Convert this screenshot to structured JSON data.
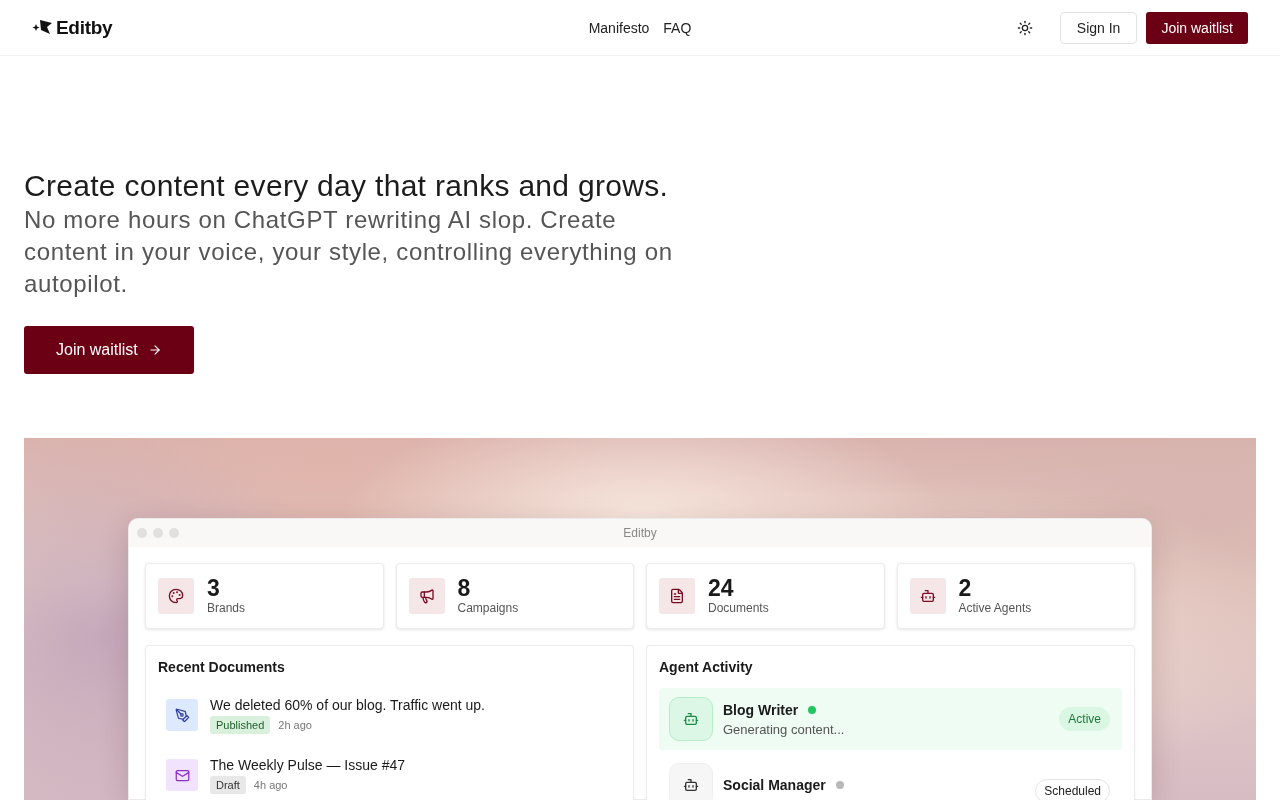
{
  "nav": {
    "logo": "Editby",
    "links": [
      {
        "label": "Manifesto"
      },
      {
        "label": "FAQ"
      }
    ],
    "sign_in": "Sign In",
    "join": "Join waitlist"
  },
  "hero": {
    "title": "Create content every day that ranks and grows.",
    "subtitle": "No more hours on ChatGPT rewriting AI slop. Create content in your voice, your style, controlling everything on autopilot.",
    "cta": "Join waitlist"
  },
  "app_window": {
    "title": "Editby",
    "stats": [
      {
        "kind": "brands",
        "value": "3",
        "label": "Brands"
      },
      {
        "kind": "campaigns",
        "value": "8",
        "label": "Campaigns"
      },
      {
        "kind": "documents",
        "value": "24",
        "label": "Documents"
      },
      {
        "kind": "agents",
        "value": "2",
        "label": "Active Agents"
      }
    ],
    "recent_documents": {
      "title": "Recent Documents",
      "items": [
        {
          "kind": "article",
          "title": "We deleted 60% of our blog. Traffic went up.",
          "status": "Published",
          "published": true,
          "time": "2h ago"
        },
        {
          "kind": "newsletter",
          "title": "The Weekly Pulse — Issue #47",
          "status": "Draft",
          "published": false,
          "time": "4h ago"
        }
      ]
    },
    "agent_activity": {
      "title": "Agent Activity",
      "agents": [
        {
          "name": "Blog Writer",
          "active": true,
          "color": "#22c55e",
          "detail": "Generating content...",
          "badge": "Active"
        },
        {
          "name": "Social Manager",
          "active": false,
          "color": "#b8b8b8",
          "badge": "Scheduled"
        }
      ]
    }
  }
}
